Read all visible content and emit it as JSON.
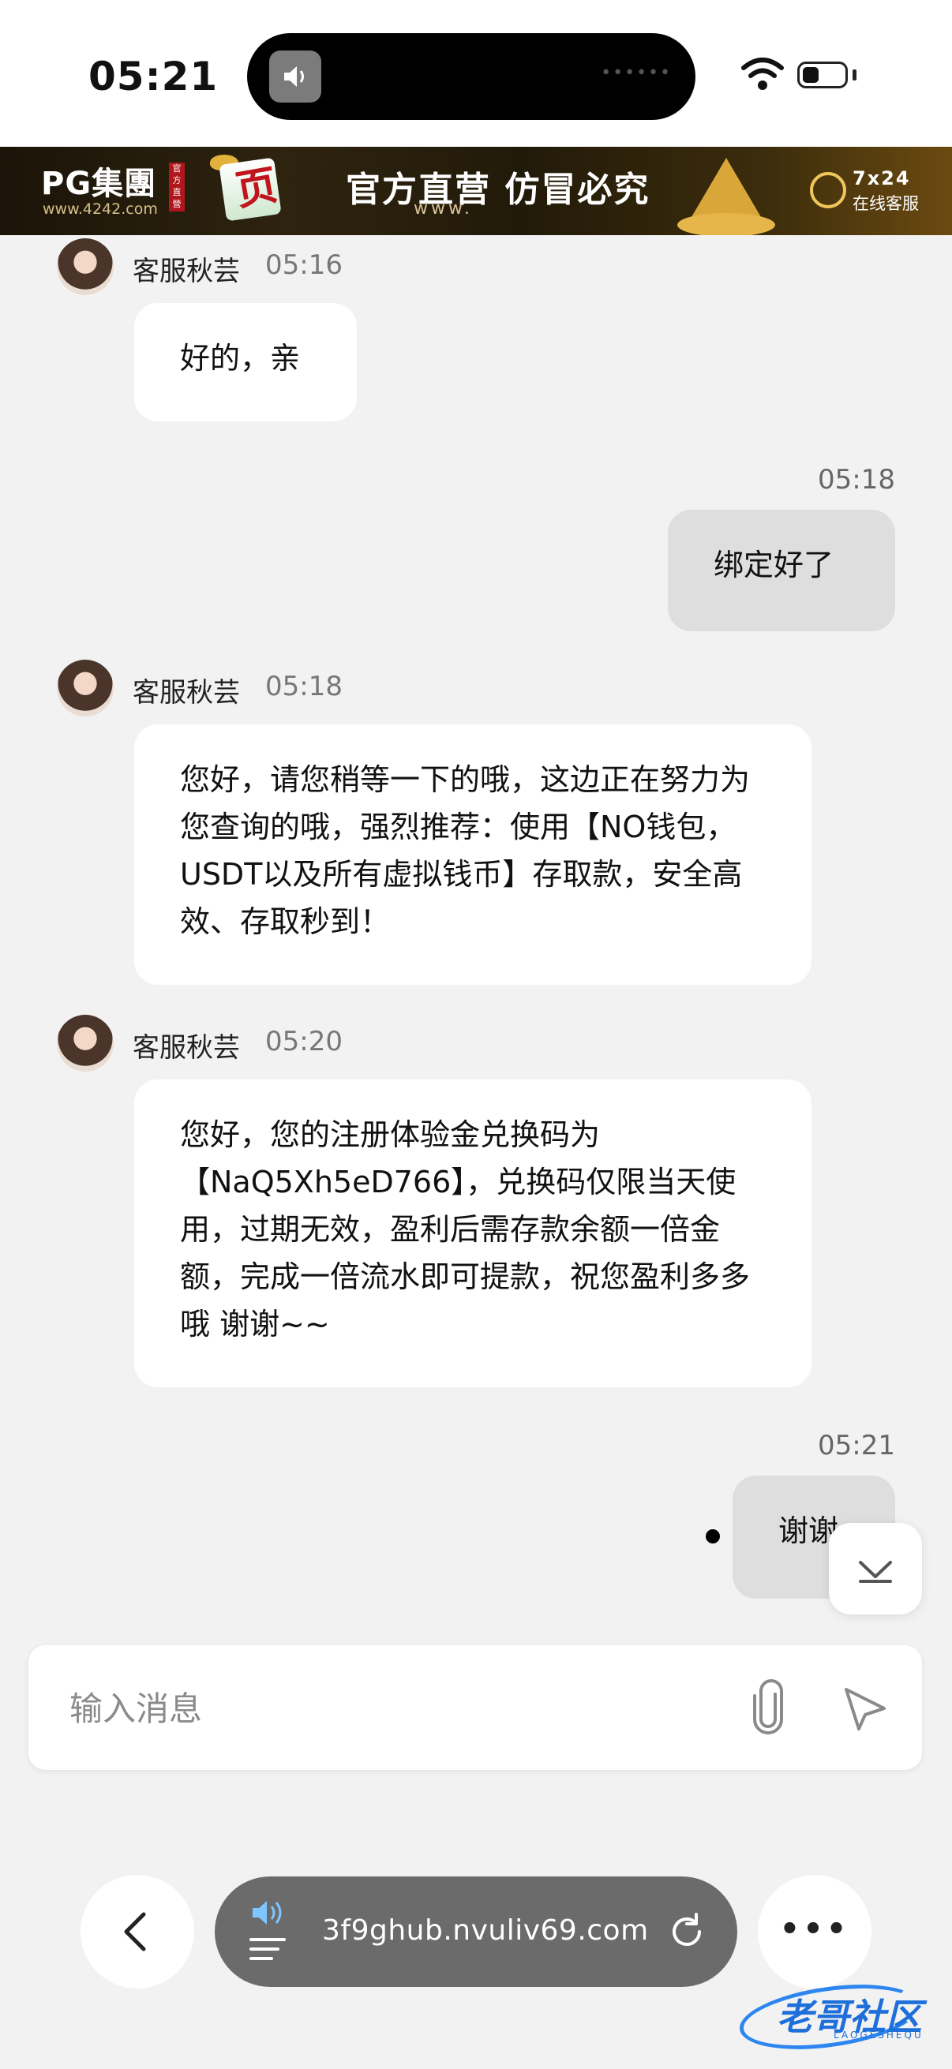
{
  "status_bar": {
    "time": "05:21"
  },
  "banner": {
    "logo": "PG集團",
    "url": "www.4242.com",
    "logo_tag": "官方直營",
    "title": "官方直营 仿冒必究",
    "www": "www.",
    "cs_hours": "7x24",
    "cs_label": "在线客服"
  },
  "messages": [
    {
      "side": "in",
      "sender": "客服秋芸",
      "time": "05:16",
      "text": "好的，亲"
    },
    {
      "side": "out",
      "time": "05:18",
      "text": "绑定好了"
    },
    {
      "side": "in",
      "sender": "客服秋芸",
      "time": "05:18",
      "text": "您好，请您稍等一下的哦，这边正在努力为您查询的哦，强烈推荐：使用【NO钱包，USDT以及所有虚拟钱币】存取款，安全高效、存取秒到！"
    },
    {
      "side": "in",
      "sender": "客服秋芸",
      "time": "05:20",
      "text": "您好，您的注册体验金兑换码为【NaQ5Xh5eD766】，兑换码仅限当天使用，过期无效，盈利后需存款余额一倍金额，完成一倍流水即可提款，祝您盈利多多哦 谢谢~~"
    },
    {
      "side": "out",
      "time": "05:21",
      "text": "谢谢"
    }
  ],
  "input": {
    "placeholder": "输入消息"
  },
  "browser": {
    "url": "3f9ghub.nvuliv69.com"
  },
  "watermark": {
    "text": "老哥社区",
    "sub": "LAOGESHEQU"
  },
  "icons": [
    "speaker-icon",
    "wifi-icon",
    "battery-icon",
    "avatar",
    "paperclip-icon",
    "send-icon",
    "chevron-down-icon",
    "back-chevron-icon",
    "reload-icon",
    "more-icon"
  ]
}
